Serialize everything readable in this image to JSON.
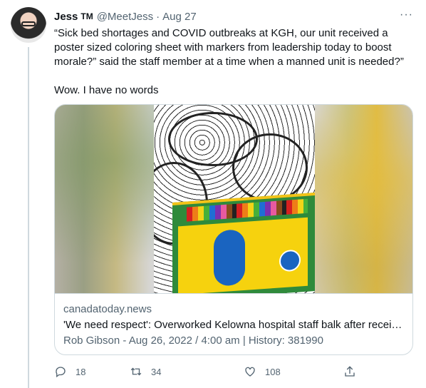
{
  "tweet": {
    "author_name": "Jess",
    "author_suffix": "TM",
    "handle": "@MeetJess",
    "separator": "·",
    "date": "Aug 27",
    "more_label": "···",
    "text_line1": "“Sick bed shortages and COVID outbreaks at KGH, our unit received a poster sized coloring sheet with markers from leadership today to boost morale?” said the staff member at a time when a manned unit is needed?”",
    "text_line2": "Wow. I have no words"
  },
  "card": {
    "domain": "canadatoday.news",
    "title": "'We need respect': Overworked Kelowna hospital staff balk after receivi...",
    "description": "Rob Gibson - Aug 26, 2022 / 4:00 am | History: 381990"
  },
  "actions": {
    "reply_count": "18",
    "retweet_count": "34",
    "like_count": "108",
    "reply_icon": "reply-icon",
    "retweet_icon": "retweet-icon",
    "like_icon": "heart-icon",
    "share_icon": "share-icon"
  },
  "colors": {
    "text": "#0f1419",
    "secondary": "#536471",
    "border": "#cfd9de"
  }
}
